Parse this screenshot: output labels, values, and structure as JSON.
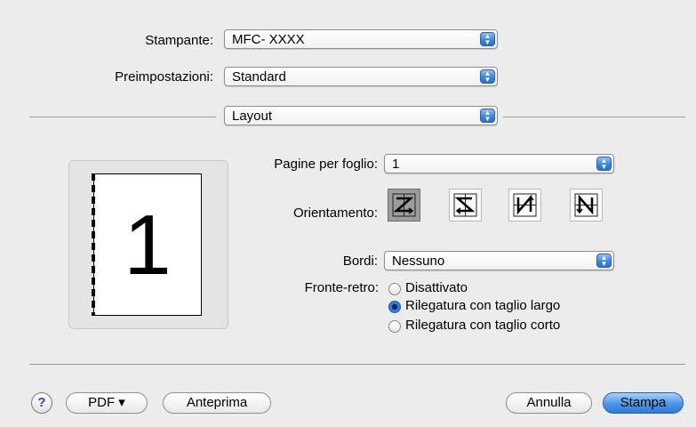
{
  "printer": {
    "label": "Stampante:",
    "value": "MFC- XXXX"
  },
  "presets": {
    "label": "Preimpostazioni:",
    "value": "Standard"
  },
  "section": {
    "value": "Layout"
  },
  "preview": {
    "page_number": "1"
  },
  "pages_per_sheet": {
    "label": "Pagine per foglio:",
    "value": "1"
  },
  "orientation": {
    "label": "Orientamento:",
    "options": [
      "orientation-z-icon",
      "orientation-reverse-z-icon",
      "orientation-reverse-n-icon",
      "orientation-n-icon"
    ],
    "selected_index": 0
  },
  "borders": {
    "label": "Bordi:",
    "value": "Nessuno"
  },
  "duplex": {
    "label": "Fronte-retro:",
    "options": [
      "Disattivato",
      "Rilegatura con taglio largo",
      "Rilegatura con taglio corto"
    ],
    "selected": "Rilegatura con taglio largo"
  },
  "footer": {
    "help": "?",
    "pdf": "PDF ▾",
    "preview": "Anteprima",
    "cancel": "Annulla",
    "print": "Stampa"
  },
  "colors": {
    "accent": "#3c86de",
    "background": "#ececec"
  }
}
